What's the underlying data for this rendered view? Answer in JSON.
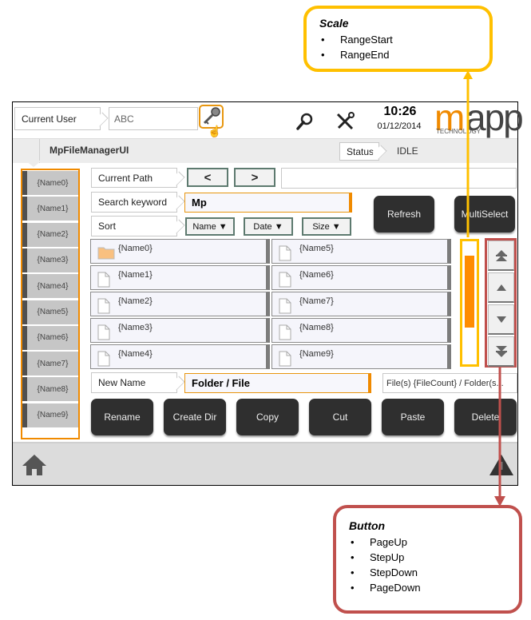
{
  "header": {
    "current_user_label": "Current User",
    "current_user_value": "ABC",
    "time": "10:26",
    "date": "01/12/2014",
    "logo_main": "mapp",
    "logo_sub": "TECHNOLOGY"
  },
  "titlebar": {
    "title": "MpFileManagerUI",
    "status_label": "Status",
    "status_value": "IDLE"
  },
  "sidebar": {
    "items": [
      {
        "label": "{Name0}"
      },
      {
        "label": "{Name1}"
      },
      {
        "label": "{Name2}"
      },
      {
        "label": "{Name3}"
      },
      {
        "label": "{Name4}"
      },
      {
        "label": "{Name5}"
      },
      {
        "label": "{Name6}"
      },
      {
        "label": "{Name7}"
      },
      {
        "label": "{Name8}"
      },
      {
        "label": "{Name9}"
      }
    ]
  },
  "main": {
    "current_path_label": "Current Path",
    "current_path_value": "",
    "back_label": "<",
    "forward_label": ">",
    "search_label": "Search keyword",
    "search_value": "Mp",
    "sort_label": "Sort",
    "sort_buttons": [
      {
        "label": "Name ▼"
      },
      {
        "label": "Date ▼"
      },
      {
        "label": "Size ▼"
      }
    ],
    "refresh_label": "Refresh",
    "multiselect_label": "MultiSelect",
    "files": [
      {
        "name": "{Name0}",
        "type": "folder"
      },
      {
        "name": "{Name1}",
        "type": "file"
      },
      {
        "name": "{Name2}",
        "type": "file"
      },
      {
        "name": "{Name3}",
        "type": "file"
      },
      {
        "name": "{Name4}",
        "type": "file"
      },
      {
        "name": "{Name5}",
        "type": "file"
      },
      {
        "name": "{Name6}",
        "type": "file"
      },
      {
        "name": "{Name7}",
        "type": "file"
      },
      {
        "name": "{Name8}",
        "type": "file"
      },
      {
        "name": "{Name9}",
        "type": "file"
      }
    ],
    "scale": {
      "range_start": 0.12,
      "range_end": 0.7
    },
    "new_name_label": "New Name",
    "new_name_value": "Folder / File",
    "file_count_text": "File(s) {FileCount} / Folder(s...",
    "actions": [
      {
        "label": "Rename"
      },
      {
        "label": "Create Dir"
      },
      {
        "label": "Copy"
      },
      {
        "label": "Cut"
      },
      {
        "label": "Paste"
      },
      {
        "label": "Delete"
      }
    ]
  },
  "callouts": {
    "scale": {
      "title": "Scale",
      "items": [
        "RangeStart",
        "RangeEnd"
      ],
      "color": "#ffc000"
    },
    "button": {
      "title": "Button",
      "items": [
        "PageUp",
        "StepUp",
        "StepDown",
        "PageDown"
      ],
      "color": "#c0504d"
    }
  },
  "colors": {
    "accent": "#f08a00",
    "dark_button": "#2f2f2f",
    "scale_callout": "#ffc000",
    "button_callout": "#c0504d"
  }
}
